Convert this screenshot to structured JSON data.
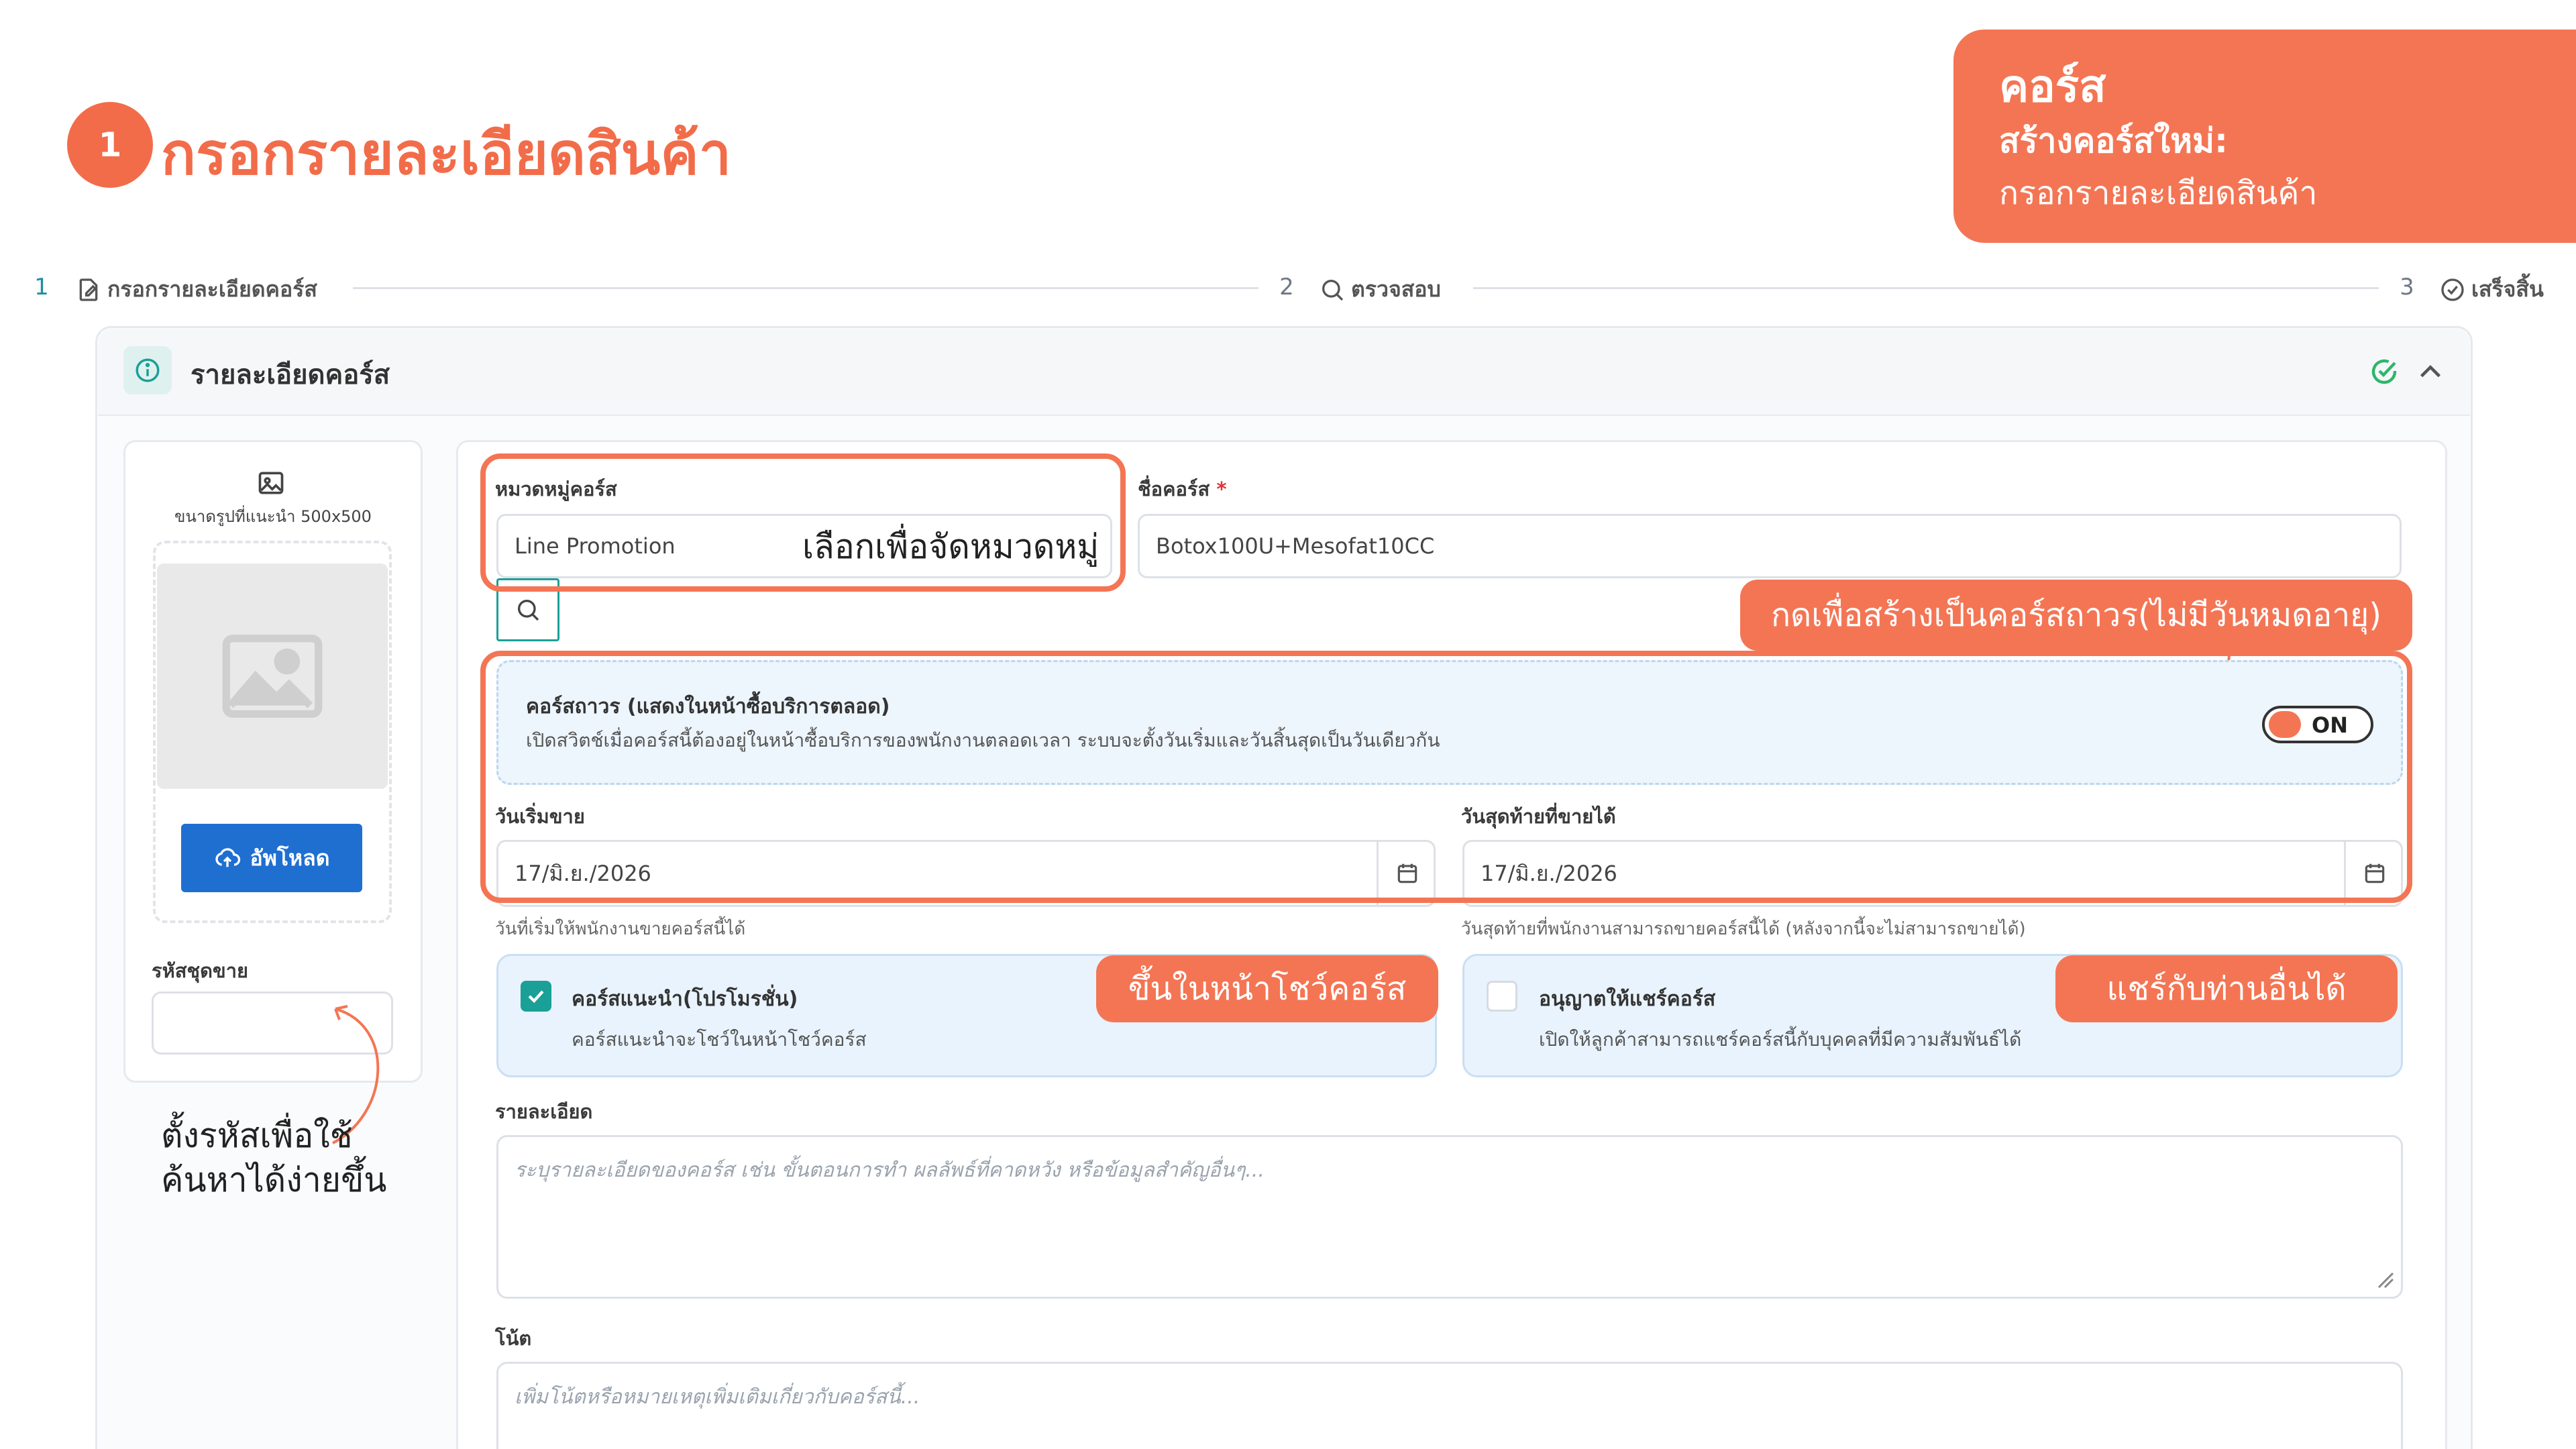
{
  "header": {
    "step_number": "1",
    "title": "กรอกรายละเอียดสินค้า"
  },
  "corner_card": {
    "line1": "คอร์ส",
    "line2": "สร้างคอร์สใหม่:",
    "line3": "กรอกรายละเอียดสินค้า"
  },
  "stepper": [
    {
      "num": "1",
      "label": "กรอกรายละเอียดคอร์ส"
    },
    {
      "num": "2",
      "label": "ตรวจสอบ"
    },
    {
      "num": "3",
      "label": "เสร็จสิ้น"
    }
  ],
  "panel": {
    "title": "รายละเอียดคอร์ส"
  },
  "image_upload": {
    "size_hint": "ขนาดรูปที่แนะนำ 500x500",
    "upload_button": "อัพโหลด",
    "code_label": "รหัสชุดขาย",
    "code_value": ""
  },
  "form": {
    "category_label": "หมวดหมู่คอร์ส",
    "category_value": "Line Promotion",
    "name_label": "ชื่อคอร์ส",
    "required_mark": "*",
    "name_value": "Botox100U+Mesofat10CC",
    "permanent_title": "คอร์สถาวร (แสดงในหน้าซื้อบริการตลอด)",
    "permanent_desc": "เปิดสวิตช์เมื่อคอร์สนี้ต้องอยู่ในหน้าซื้อบริการของพนักงานตลอดเวลา ระบบจะตั้งวันเริ่มและวันสิ้นสุดเป็นวันเดียวกัน",
    "toggle_label": "ON",
    "start_label": "วันเริ่มขาย",
    "start_value": "17/มิ.ย./2026",
    "start_hint": "วันที่เริ่มให้พนักงานขายคอร์สนี้ได้",
    "end_label": "วันสุดท้ายที่ขายได้",
    "end_value": "17/มิ.ย./2026",
    "end_hint": "วันสุดท้ายที่พนักงานสามารถขายคอร์สนี้ได้ (หลังจากนี้จะไม่สามารถขายได้)",
    "recommend_title": "คอร์สแนะนำ(โปรโมรชั่น)",
    "recommend_desc": "คอร์สแนะนำจะโชว์ในหน้าโชว์คอร์ส",
    "recommend_checked": true,
    "share_title": "อนุญาตให้แชร์คอร์ส",
    "share_desc": "เปิดให้ลูกค้าสามารถแชร์คอร์สนี้กับบุคคลที่มีความสัมพันธ์ได้",
    "share_checked": false,
    "detail_label": "รายละเอียด",
    "detail_placeholder": "ระบุรายละเอียดของคอร์ส เช่น ขั้นตอนการทำ ผลลัพธ์ที่คาดหวัง หรือข้อมูลสำคัญอื่นๆ...",
    "note_label": "โน้ต",
    "note_placeholder": "เพิ่มโน้ตหรือหมายเหตุเพิ่มเติมเกี่ยวกับคอร์สนี้..."
  },
  "annotations": {
    "category_callout": "เลือกเพื่อจัดหมวดหมู่",
    "permanent_callout": "กดเพื่อสร้างเป็นคอร์สถาวร(ไม่มีวันหมดอายุ)",
    "recommend_callout": "ขึ้นในหน้าโชว์คอร์ส",
    "share_callout": "แชร์กับท่านอื่นได้",
    "code_note_line1": "ตั้งรหัสเพื่อใช้",
    "code_note_line2": "ค้นหาได้ง่ายขึ้น"
  },
  "colors": {
    "accent_orange": "#f47554",
    "upload_blue": "#1f6fd1",
    "teal_check": "#1aa097"
  }
}
